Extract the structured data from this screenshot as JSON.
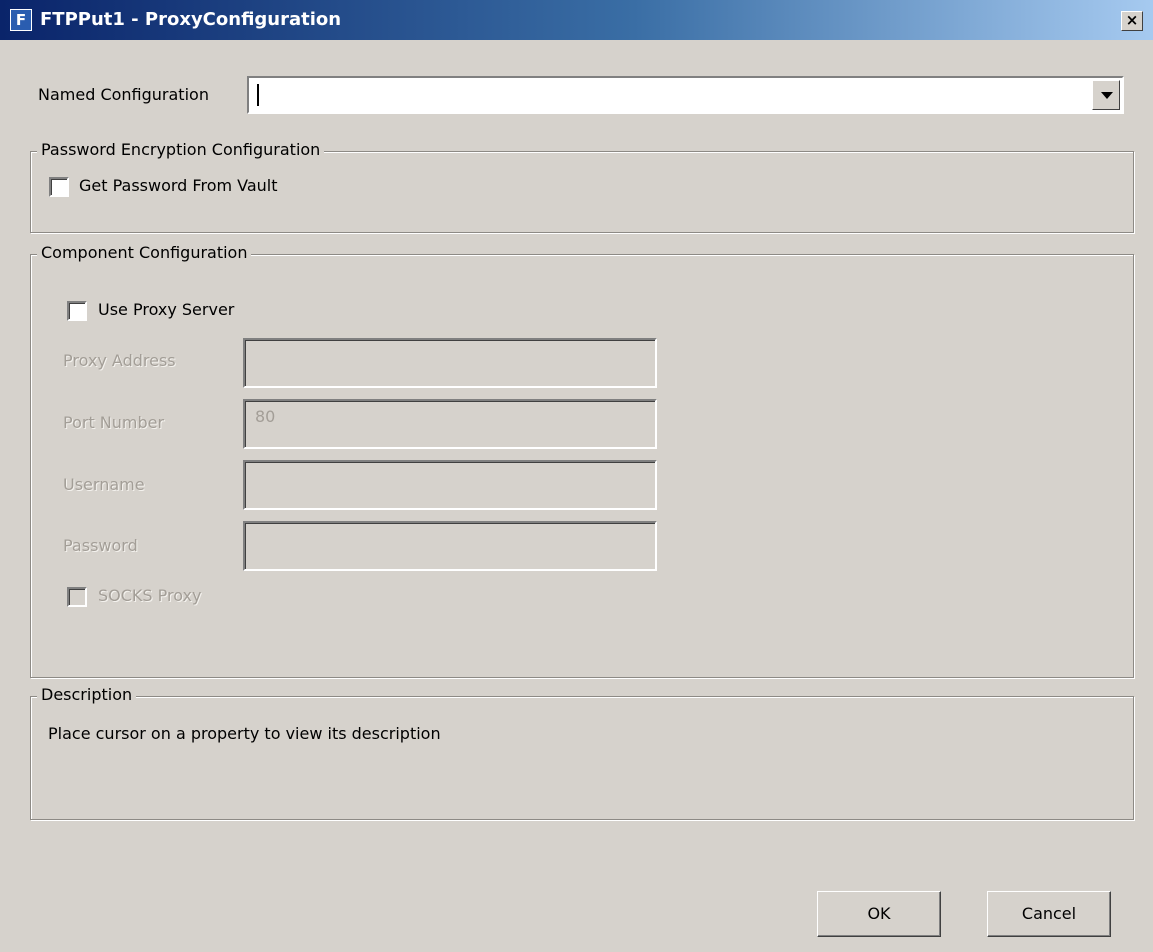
{
  "window": {
    "title": "FTPPut1 - ProxyConfiguration",
    "app_icon_letter": "F",
    "close_glyph": "×"
  },
  "named_configuration": {
    "label": "Named Configuration",
    "value": ""
  },
  "password_group": {
    "legend": "Password Encryption Configuration",
    "get_password_label": "Get Password From Vault",
    "get_password_checked": false
  },
  "component_group": {
    "legend": "Component Configuration",
    "use_proxy_label": "Use Proxy Server",
    "use_proxy_checked": false,
    "proxy_address_label": "Proxy Address",
    "proxy_address_value": "",
    "port_label": "Port Number",
    "port_value": "80",
    "username_label": "Username",
    "username_value": "",
    "password_label": "Password",
    "password_value": "",
    "socks_label": "SOCKS Proxy",
    "socks_checked": false
  },
  "description_group": {
    "legend": "Description",
    "text": "Place cursor on a property to view its description"
  },
  "buttons": {
    "ok": "OK",
    "cancel": "Cancel"
  },
  "colors": {
    "dialog_background": "#d6d2cc",
    "title_gradient_start": "#0a246a",
    "title_gradient_end": "#a6caf0",
    "disabled_text": "#a39e97"
  }
}
